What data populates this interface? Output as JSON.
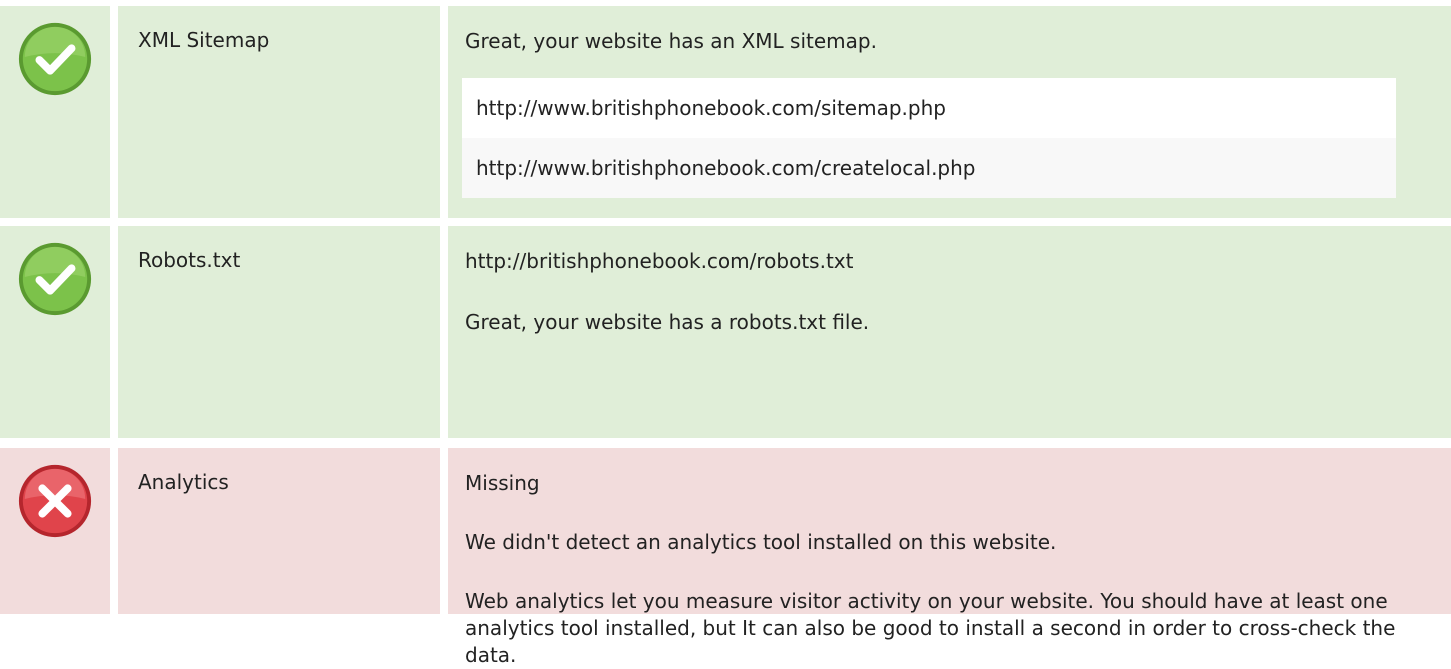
{
  "colors": {
    "pass_background": "#e0eed8",
    "fail_background": "#f2dcdc",
    "pass_icon": "#6ab33e",
    "fail_icon": "#d7333b"
  },
  "rows": {
    "sitemap": {
      "status": "pass",
      "icon": "check-circle-icon",
      "name": "XML Sitemap",
      "message": "Great, your website has an XML sitemap.",
      "urls": [
        "http://www.britishphonebook.com/sitemap.php",
        "http://www.britishphonebook.com/createlocal.php"
      ]
    },
    "robots": {
      "status": "pass",
      "icon": "check-circle-icon",
      "name": "Robots.txt",
      "url": "http://britishphonebook.com/robots.txt",
      "message": "Great, your website has a robots.txt file."
    },
    "analytics": {
      "status": "fail",
      "icon": "x-circle-icon",
      "name": "Analytics",
      "status_text": "Missing",
      "message": "We didn't detect an analytics tool installed on this website.",
      "advice": "Web analytics let you measure visitor activity on your website. You should have at least one analytics tool installed, but It can also be good to install a second in order to cross-check the data."
    }
  }
}
